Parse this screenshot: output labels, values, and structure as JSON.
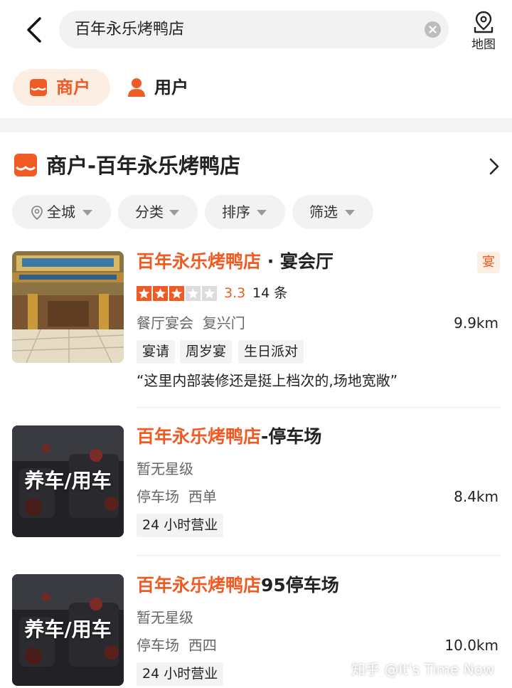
{
  "search": {
    "query": "百年永乐烤鸭店"
  },
  "header": {
    "map_label": "地图"
  },
  "tabs": [
    {
      "label": "商户",
      "active": true
    },
    {
      "label": "用户",
      "active": false
    }
  ],
  "section": {
    "title": "商户-百年永乐烤鸭店"
  },
  "filters": [
    {
      "label": "全城",
      "icon": "location-pin-icon"
    },
    {
      "label": "分类"
    },
    {
      "label": "排序"
    },
    {
      "label": "筛选"
    }
  ],
  "results": [
    {
      "name_highlight": "百年永乐烤鸭店",
      "name_suffix": " · 宴会厅",
      "badge": "宴",
      "rating_value": 3,
      "rating_max": 5,
      "score": "3.3",
      "reviews": "14 条",
      "category": "餐厅宴会",
      "area": "复兴门",
      "distance": "9.9km",
      "tags": [
        "宴请",
        "周岁宴",
        "生日派对"
      ],
      "quote": "“这里内部装修还是挺上档次的,场地宽敞”"
    },
    {
      "name_highlight": "百年永乐烤鸭店",
      "name_suffix": "-停车场",
      "thumb_label": "养车/用车",
      "rating_text": "暂无星级",
      "category": "停车场",
      "area": "西单",
      "distance": "8.4km",
      "tags": [
        "24 小时营业"
      ]
    },
    {
      "name_highlight": "百年永乐烤鸭店",
      "name_suffix": "95停车场",
      "thumb_label": "养车/用车",
      "rating_text": "暂无星级",
      "category": "停车场",
      "area": "西四",
      "distance": "10.0km",
      "tags": [
        "24 小时营业"
      ]
    }
  ],
  "watermark": "知乎 @It's Time Now",
  "colors": {
    "accent": "#f05a23",
    "accent_bg": "#fdeee4",
    "chip_bg": "#f2f2f2",
    "star": "#f05a23"
  }
}
